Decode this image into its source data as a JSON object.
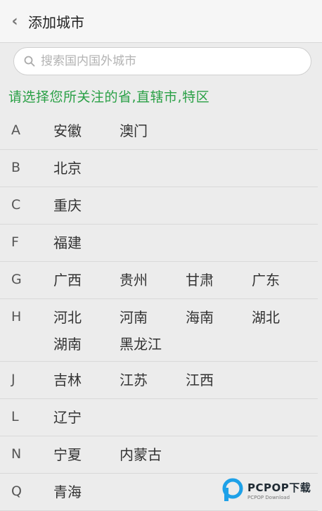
{
  "header": {
    "back_icon": "chevron-left-icon",
    "title": "添加城市"
  },
  "search": {
    "icon": "search-icon",
    "placeholder": "搜索国内国外城市",
    "value": ""
  },
  "prompt": "请选择您所关注的省,直辖市,特区",
  "groups": [
    {
      "letter": "A",
      "cities": [
        "安徽",
        "澳门"
      ]
    },
    {
      "letter": "B",
      "cities": [
        "北京"
      ]
    },
    {
      "letter": "C",
      "cities": [
        "重庆"
      ]
    },
    {
      "letter": "F",
      "cities": [
        "福建"
      ]
    },
    {
      "letter": "G",
      "cities": [
        "广西",
        "贵州",
        "甘肃",
        "广东"
      ]
    },
    {
      "letter": "H",
      "cities": [
        "河北",
        "河南",
        "海南",
        "湖北",
        "湖南",
        "黑龙江"
      ]
    },
    {
      "letter": "J",
      "cities": [
        "吉林",
        "江苏",
        "江西"
      ]
    },
    {
      "letter": "L",
      "cities": [
        "辽宁"
      ]
    },
    {
      "letter": "N",
      "cities": [
        "宁夏",
        "内蒙古"
      ]
    },
    {
      "letter": "Q",
      "cities": [
        "青海"
      ]
    }
  ],
  "watermark": {
    "brand": "PCPOP下载",
    "sub": "PCPOP Download",
    "accent": "#1ea1e8"
  },
  "colors": {
    "prompt": "#2aa046",
    "background": "#ececec"
  }
}
